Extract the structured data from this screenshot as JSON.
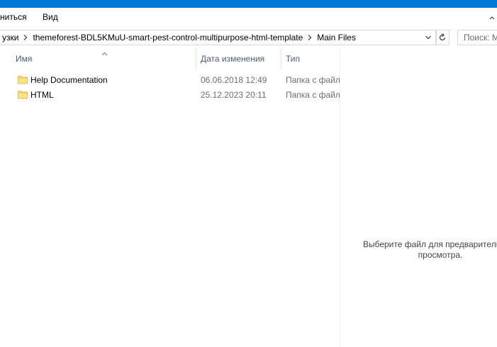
{
  "ribbon": {
    "tabs": [
      {
        "label": "нитьcя"
      },
      {
        "label": "Вид"
      }
    ]
  },
  "address": {
    "crumbs": [
      {
        "label": "узки"
      },
      {
        "label": "themeforest-BDL5KMuU-smart-pest-control-multipurpose-html-template"
      },
      {
        "label": "Main Files"
      }
    ],
    "search_placeholder": "Поиск: M"
  },
  "columns": {
    "name": "Имя",
    "date": "Дата изменения",
    "type": "Тип"
  },
  "files": [
    {
      "name": "Help Documentation",
      "date": "06.06.2018 12:49",
      "type": "Папка с файлами"
    },
    {
      "name": "HTML",
      "date": "25.12.2023 20:11",
      "type": "Папка с файлами"
    }
  ],
  "preview": {
    "message_line1": "Выберите файл для предварительного",
    "message_line2": "просмотра."
  },
  "colors": {
    "titlebar": "#0078d7",
    "folder": "#ffd86e",
    "header_text": "#4c607a"
  }
}
